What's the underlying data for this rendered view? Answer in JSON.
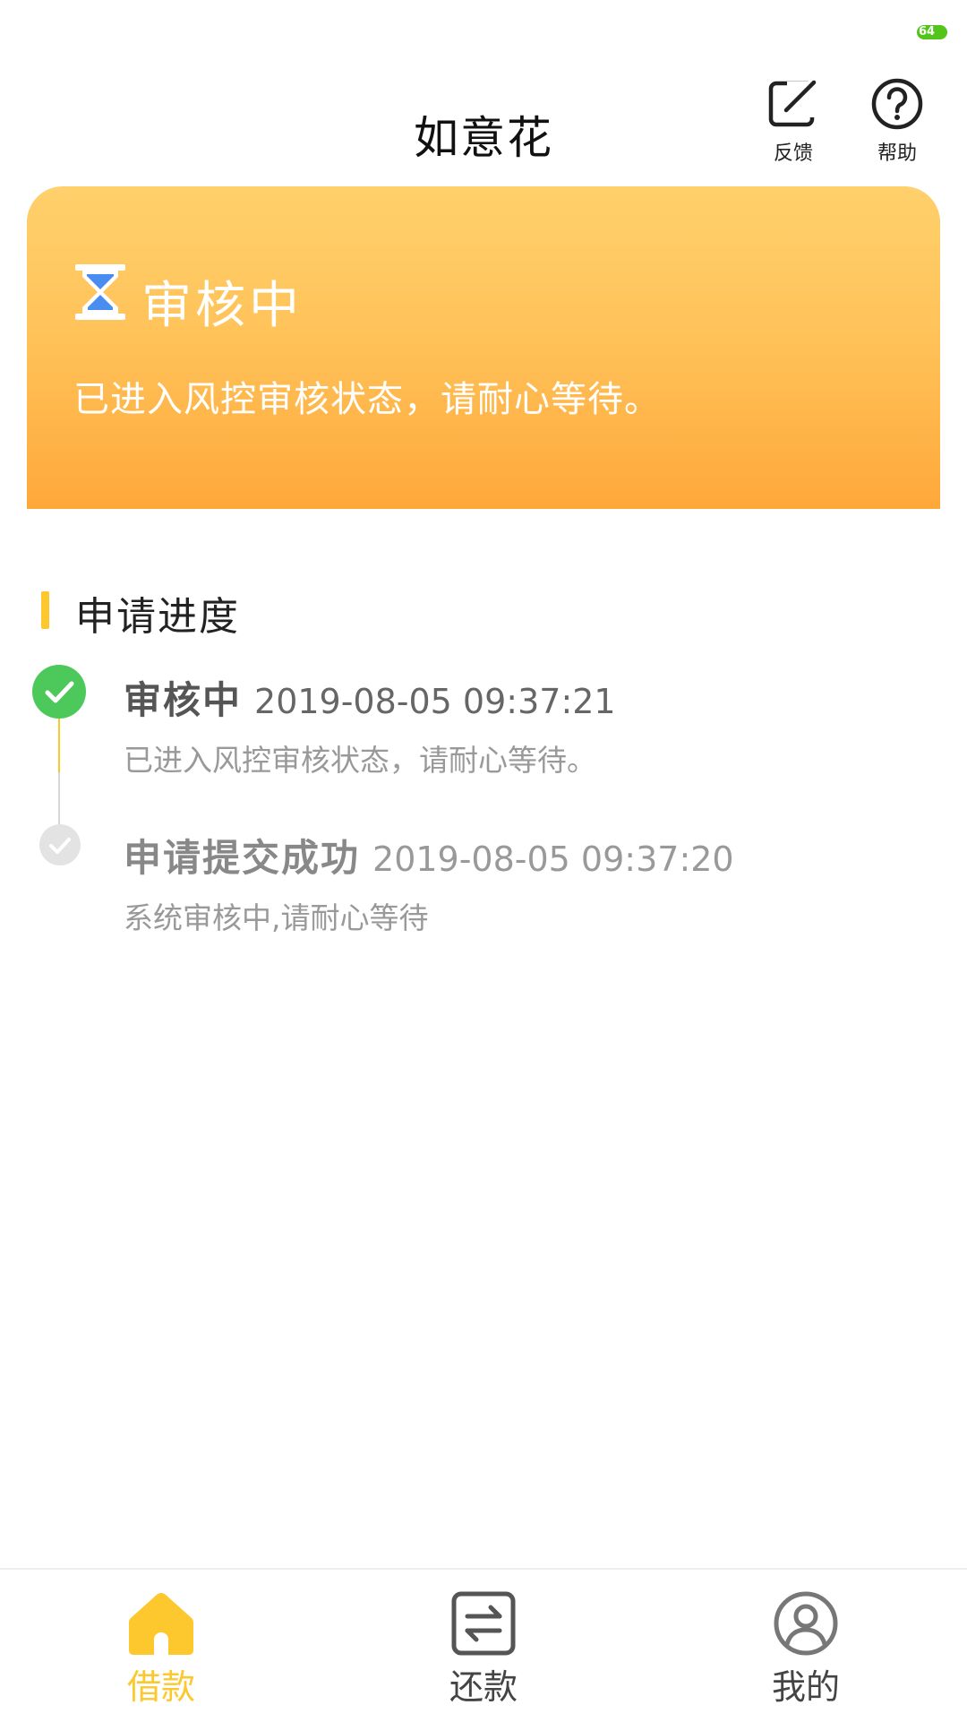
{
  "status_bar": {
    "battery": "64"
  },
  "header": {
    "title": "如意花",
    "feedback_label": "反馈",
    "help_label": "帮助"
  },
  "status_card": {
    "title": "审核中",
    "description": "已进入风控审核状态，请耐心等待。",
    "icon": "hourglass-icon",
    "gradient_colors": [
      "#ffd06c",
      "#ffa83a"
    ]
  },
  "progress": {
    "section_title": "申请进度",
    "steps": [
      {
        "name": "审核中",
        "time": "2019-08-05 09:37:21",
        "description": "已进入风控审核状态，请耐心等待。",
        "state": "current"
      },
      {
        "name": "申请提交成功",
        "time": "2019-08-05 09:37:20",
        "description": "系统审核中,请耐心等待",
        "state": "past"
      }
    ]
  },
  "tabs": [
    {
      "label": "借款",
      "icon": "home-icon",
      "active": true
    },
    {
      "label": "还款",
      "icon": "exchange-icon",
      "active": false
    },
    {
      "label": "我的",
      "icon": "profile-icon",
      "active": false
    }
  ],
  "colors": {
    "accent": "#fcc82d",
    "success": "#4cc95a",
    "battery": "#52c41a"
  }
}
